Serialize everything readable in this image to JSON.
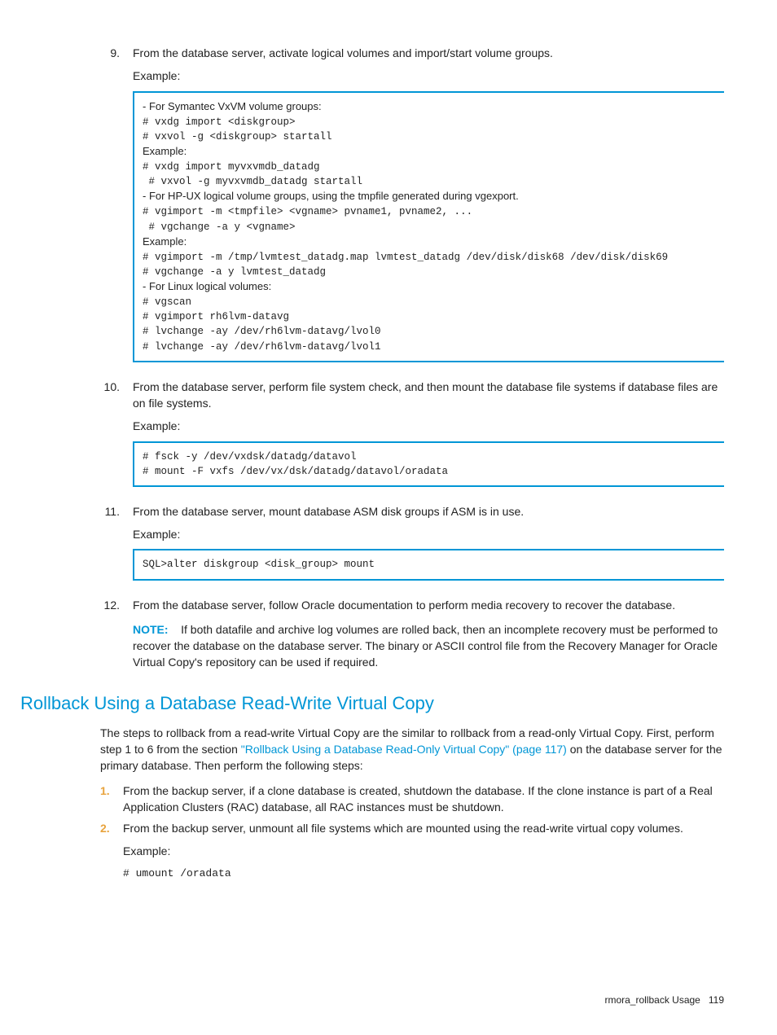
{
  "steps": {
    "s9": {
      "num": "9.",
      "text": "From the database server, activate logical volumes and import/start volume groups.",
      "example_label": "Example:",
      "code": {
        "l1": "- For Symantec VxVM volume groups:",
        "l2": "# vxdg import <diskgroup>",
        "l3": "# vxvol -g <diskgroup> startall",
        "l4": "Example:",
        "l5": "# vxdg import myvxvmdb_datadg",
        "l6": " # vxvol -g myvxvmdb_datadg startall",
        "l7": "- For HP-UX logical volume groups, using the tmpfile generated during vgexport.",
        "l8": "# vgimport -m <tmpfile> <vgname> pvname1, pvname2, ...",
        "l9": " # vgchange -a y <vgname>",
        "l10": "Example:",
        "l11": "# vgimport -m /tmp/lvmtest_datadg.map lvmtest_datadg /dev/disk/disk68 /dev/disk/disk69",
        "l12": "# vgchange -a y lvmtest_datadg",
        "l13": "- For Linux logical volumes:",
        "l14": "# vgscan",
        "l15": "# vgimport rh6lvm-datavg",
        "l16": "# lvchange -ay /dev/rh6lvm-datavg/lvol0",
        "l17": "# lvchange -ay /dev/rh6lvm-datavg/lvol1"
      }
    },
    "s10": {
      "num": "10.",
      "text": "From the database server, perform file system check, and then mount the database file systems if database files are on file systems.",
      "example_label": "Example:",
      "code": "# fsck -y /dev/vxdsk/datadg/datavol\n# mount -F vxfs /dev/vx/dsk/datadg/datavol/oradata"
    },
    "s11": {
      "num": "11.",
      "text": "From the database server, mount database ASM disk groups if ASM is in use.",
      "example_label": "Example:",
      "code": "SQL>alter diskgroup <disk_group> mount"
    },
    "s12": {
      "num": "12.",
      "text": "From the database server, follow Oracle documentation to perform media recovery to recover the database.",
      "note_label": "NOTE:",
      "note_text": "If both datafile and archive log volumes are rolled back, then an incomplete recovery must be performed to recover the database on the database server. The binary or ASCII control file from the Recovery Manager for Oracle Virtual Copy's repository can be used if required."
    }
  },
  "section": {
    "title": "Rollback Using a Database Read-Write Virtual Copy",
    "intro_pre": "The steps to rollback from a read-write Virtual Copy are the similar to rollback from a read-only Virtual Copy. First, perform step 1 to 6 from the section ",
    "intro_link": "\"Rollback Using a Database Read-Only Virtual Copy\" (page 117)",
    "intro_post": " on the database server for the primary database. Then perform the following steps:",
    "items": {
      "i1": {
        "num": "1.",
        "text": "From the backup server, if a clone database is created, shutdown the database. If the clone instance is part of a Real Application Clusters (RAC) database, all RAC instances must be shutdown."
      },
      "i2": {
        "num": "2.",
        "text": "From the backup server, unmount all file systems which are mounted using the read-write virtual copy volumes.",
        "example_label": "Example:",
        "code": "# umount /oradata"
      }
    }
  },
  "footer": {
    "text": "rmora_rollback Usage",
    "page": "119"
  }
}
